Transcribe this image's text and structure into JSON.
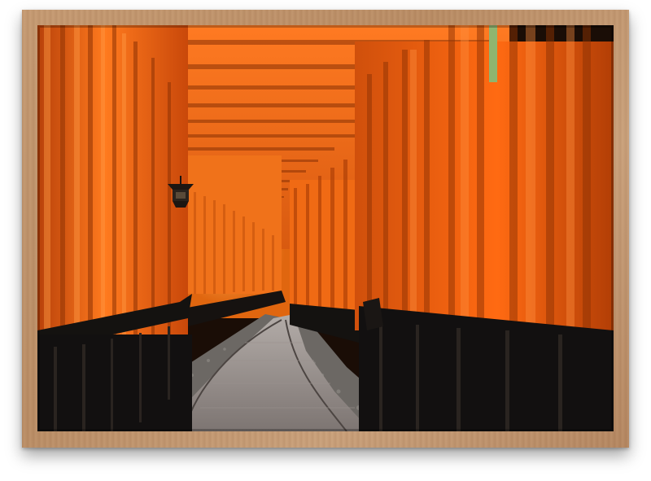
{
  "artwork": {
    "subject": "torii-gate-tunnel-photo",
    "colors": {
      "frame": "#c49a72",
      "vermilion": "#e85d0c",
      "vermilion_dark": "#a83a05",
      "pillar_base": "#141414",
      "path": "#8c8784",
      "gravel": "#6e6a66"
    }
  }
}
